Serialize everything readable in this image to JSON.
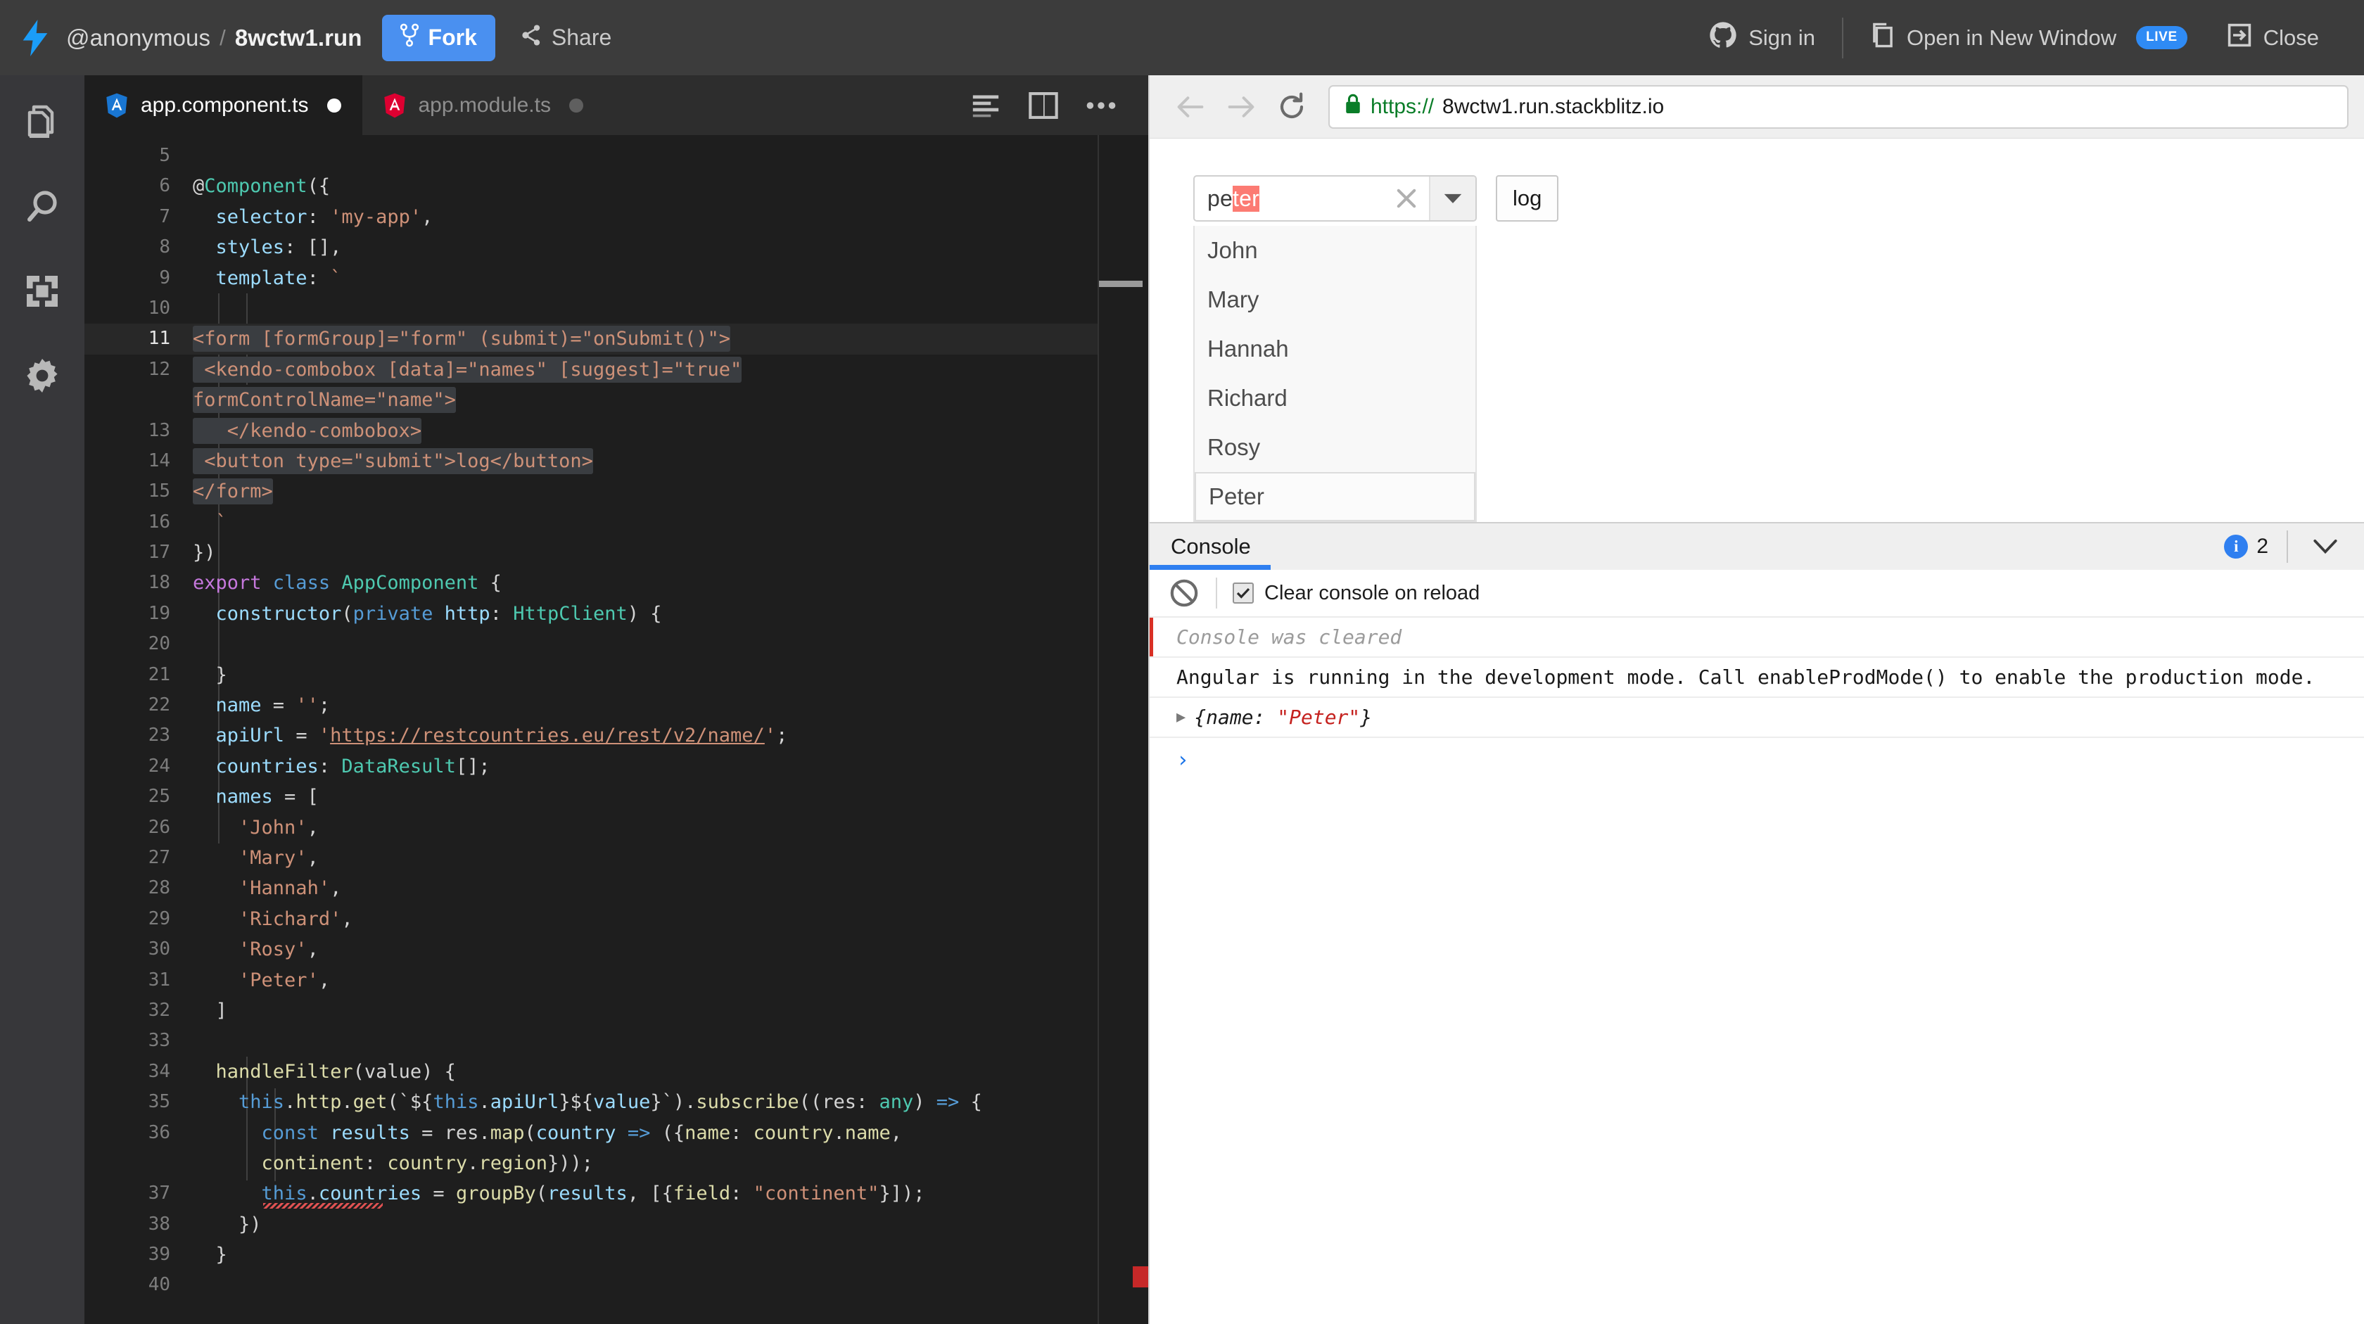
{
  "topbar": {
    "logo_icon": "lightning-bolt-icon",
    "user": "@anonymous",
    "separator": "/",
    "project": "8wctw1.run",
    "fork_label": "Fork",
    "fork_icon": "fork-icon",
    "share_label": "Share",
    "share_icon": "share-icon",
    "signin_label": "Sign in",
    "signin_icon": "github-icon",
    "open_new_window_label": "Open in New Window",
    "open_new_window_icon": "new-window-icon",
    "live_badge": "LIVE",
    "close_label": "Close",
    "close_icon": "exit-icon",
    "accent_color": "#4a90f0",
    "bar_color": "#3c3c3c"
  },
  "activitybar": {
    "items": [
      {
        "icon": "files-icon",
        "name": "project-files"
      },
      {
        "icon": "search-icon",
        "name": "search"
      },
      {
        "icon": "dependencies-icon",
        "name": "dependencies"
      },
      {
        "icon": "gear-icon",
        "name": "settings"
      }
    ]
  },
  "editor": {
    "tabs": [
      {
        "label": "app.component.ts",
        "icon": "angular-icon-blue",
        "active": true,
        "dirty": true
      },
      {
        "label": "app.module.ts",
        "icon": "angular-icon-red",
        "active": false,
        "dirty": true
      }
    ],
    "actions": [
      {
        "icon": "format-lines-icon",
        "name": "format-code"
      },
      {
        "icon": "split-editor-icon",
        "name": "split-editor"
      },
      {
        "icon": "more-options-icon",
        "name": "more-options"
      }
    ],
    "current_line": 11,
    "first_visible_line": 5,
    "lines": [
      {
        "n": "5",
        "blank": true
      },
      {
        "n": "6",
        "tokens": [
          {
            "t": "@",
            "c": "t-plain"
          },
          {
            "t": "Component",
            "c": "t-type"
          },
          {
            "t": "({",
            "c": "t-plain"
          }
        ]
      },
      {
        "n": "7",
        "tokens": [
          {
            "t": "  ",
            "c": "t-plain"
          },
          {
            "t": "selector",
            "c": "t-prop"
          },
          {
            "t": ": ",
            "c": "t-plain"
          },
          {
            "t": "'my-app'",
            "c": "t-str"
          },
          {
            "t": ",",
            "c": "t-plain"
          }
        ]
      },
      {
        "n": "8",
        "tokens": [
          {
            "t": "  ",
            "c": "t-plain"
          },
          {
            "t": "styles",
            "c": "t-prop"
          },
          {
            "t": ": [],",
            "c": "t-plain"
          }
        ]
      },
      {
        "n": "9",
        "tokens": [
          {
            "t": "  ",
            "c": "t-plain"
          },
          {
            "t": "template",
            "c": "t-prop"
          },
          {
            "t": ": ",
            "c": "t-plain"
          },
          {
            "t": "`",
            "c": "t-str"
          }
        ]
      },
      {
        "n": "10",
        "tokens": []
      },
      {
        "n": "11",
        "cur": true,
        "tokens": [
          {
            "t": "<form [formGroup]=\"form\" (submit)=\"onSubmit()\">",
            "c": "t-str",
            "sel": true
          }
        ]
      },
      {
        "n": "12",
        "tokens": [
          {
            "t": " <kendo-combobox [data]=\"names\" [suggest]=\"true\"",
            "c": "t-str",
            "sel": true
          }
        ]
      },
      {
        "n": "",
        "tokens": [
          {
            "t": "formControlName=\"name\">",
            "c": "t-str",
            "sel": true
          }
        ]
      },
      {
        "n": "13",
        "tokens": [
          {
            "t": "   </kendo-combobox>",
            "c": "t-str",
            "sel": true
          }
        ]
      },
      {
        "n": "14",
        "tokens": [
          {
            "t": " <button type=\"submit\">log</button>",
            "c": "t-str",
            "sel": true
          }
        ]
      },
      {
        "n": "15",
        "tokens": [
          {
            "t": "</form>",
            "c": "t-str",
            "sel": true
          }
        ]
      },
      {
        "n": "16",
        "tokens": [
          {
            "t": "  `",
            "c": "t-str"
          }
        ]
      },
      {
        "n": "17",
        "tokens": [
          {
            "t": "})",
            "c": "t-plain"
          }
        ]
      },
      {
        "n": "18",
        "tokens": [
          {
            "t": "export ",
            "c": "t-kw"
          },
          {
            "t": "class ",
            "c": "t-kw2"
          },
          {
            "t": "AppComponent",
            "c": "t-type"
          },
          {
            "t": " {",
            "c": "t-plain"
          }
        ]
      },
      {
        "n": "19",
        "tokens": [
          {
            "t": "  ",
            "c": "t-plain"
          },
          {
            "t": "constructor",
            "c": "t-prop"
          },
          {
            "t": "(",
            "c": "t-plain"
          },
          {
            "t": "private",
            "c": "t-kw2"
          },
          {
            "t": " ",
            "c": "t-plain"
          },
          {
            "t": "http",
            "c": "t-prop"
          },
          {
            "t": ": ",
            "c": "t-plain"
          },
          {
            "t": "HttpClient",
            "c": "t-type"
          },
          {
            "t": ") {",
            "c": "t-plain"
          }
        ]
      },
      {
        "n": "20",
        "tokens": []
      },
      {
        "n": "21",
        "tokens": [
          {
            "t": "  }",
            "c": "t-plain"
          }
        ]
      },
      {
        "n": "22",
        "tokens": [
          {
            "t": "  ",
            "c": "t-plain"
          },
          {
            "t": "name",
            "c": "t-prop"
          },
          {
            "t": " = ",
            "c": "t-plain"
          },
          {
            "t": "''",
            "c": "t-str"
          },
          {
            "t": ";",
            "c": "t-plain"
          }
        ]
      },
      {
        "n": "23",
        "tokens": [
          {
            "t": "  ",
            "c": "t-plain"
          },
          {
            "t": "apiUrl",
            "c": "t-prop"
          },
          {
            "t": " = ",
            "c": "t-plain"
          },
          {
            "t": "'",
            "c": "t-str"
          },
          {
            "t": "https://restcountries.eu/rest/v2/name/",
            "c": "t-str",
            "url": true
          },
          {
            "t": "'",
            "c": "t-str"
          },
          {
            "t": ";",
            "c": "t-plain"
          }
        ]
      },
      {
        "n": "24",
        "tokens": [
          {
            "t": "  ",
            "c": "t-plain"
          },
          {
            "t": "countries",
            "c": "t-prop"
          },
          {
            "t": ": ",
            "c": "t-plain"
          },
          {
            "t": "DataResult",
            "c": "t-type"
          },
          {
            "t": "[];",
            "c": "t-plain"
          }
        ]
      },
      {
        "n": "25",
        "tokens": [
          {
            "t": "  ",
            "c": "t-plain"
          },
          {
            "t": "names",
            "c": "t-prop"
          },
          {
            "t": " = [",
            "c": "t-plain"
          }
        ]
      },
      {
        "n": "26",
        "tokens": [
          {
            "t": "    ",
            "c": "t-plain"
          },
          {
            "t": "'John'",
            "c": "t-str"
          },
          {
            "t": ",",
            "c": "t-plain"
          }
        ]
      },
      {
        "n": "27",
        "tokens": [
          {
            "t": "    ",
            "c": "t-plain"
          },
          {
            "t": "'Mary'",
            "c": "t-str"
          },
          {
            "t": ",",
            "c": "t-plain"
          }
        ]
      },
      {
        "n": "28",
        "tokens": [
          {
            "t": "    ",
            "c": "t-plain"
          },
          {
            "t": "'Hannah'",
            "c": "t-str"
          },
          {
            "t": ",",
            "c": "t-plain"
          }
        ]
      },
      {
        "n": "29",
        "tokens": [
          {
            "t": "    ",
            "c": "t-plain"
          },
          {
            "t": "'Richard'",
            "c": "t-str"
          },
          {
            "t": ",",
            "c": "t-plain"
          }
        ]
      },
      {
        "n": "30",
        "tokens": [
          {
            "t": "    ",
            "c": "t-plain"
          },
          {
            "t": "'Rosy'",
            "c": "t-str"
          },
          {
            "t": ",",
            "c": "t-plain"
          }
        ]
      },
      {
        "n": "31",
        "tokens": [
          {
            "t": "    ",
            "c": "t-plain"
          },
          {
            "t": "'Peter'",
            "c": "t-str"
          },
          {
            "t": ",",
            "c": "t-plain"
          }
        ]
      },
      {
        "n": "32",
        "tokens": [
          {
            "t": "  ]",
            "c": "t-plain"
          }
        ]
      },
      {
        "n": "33",
        "tokens": []
      },
      {
        "n": "34",
        "tokens": [
          {
            "t": "  ",
            "c": "t-plain"
          },
          {
            "t": "handleFilter",
            "c": "t-fn"
          },
          {
            "t": "(",
            "c": "t-plain"
          },
          {
            "t": "value",
            "c": "t-plain"
          },
          {
            "t": ") {",
            "c": "t-plain"
          }
        ]
      },
      {
        "n": "35",
        "tokens": [
          {
            "t": "    ",
            "c": "t-plain"
          },
          {
            "t": "this",
            "c": "t-kw2"
          },
          {
            "t": ".",
            "c": "t-plain"
          },
          {
            "t": "http",
            "c": "t-fn"
          },
          {
            "t": ".",
            "c": "t-plain"
          },
          {
            "t": "get",
            "c": "t-fn"
          },
          {
            "t": "(`${",
            "c": "t-plain"
          },
          {
            "t": "this",
            "c": "t-kw2"
          },
          {
            "t": ".",
            "c": "t-plain"
          },
          {
            "t": "apiUrl",
            "c": "t-prop"
          },
          {
            "t": "}${",
            "c": "t-plain"
          },
          {
            "t": "value",
            "c": "t-prop"
          },
          {
            "t": "}`).",
            "c": "t-plain"
          },
          {
            "t": "subscribe",
            "c": "t-fn"
          },
          {
            "t": "((",
            "c": "t-plain"
          },
          {
            "t": "res",
            "c": "t-plain"
          },
          {
            "t": ": ",
            "c": "t-plain"
          },
          {
            "t": "any",
            "c": "t-type"
          },
          {
            "t": ") ",
            "c": "t-plain"
          },
          {
            "t": "=>",
            "c": "t-arrow"
          },
          {
            "t": " {",
            "c": "t-plain"
          }
        ]
      },
      {
        "n": "36",
        "tokens": [
          {
            "t": "      ",
            "c": "t-plain"
          },
          {
            "t": "const",
            "c": "t-kw2"
          },
          {
            "t": " ",
            "c": "t-plain"
          },
          {
            "t": "results",
            "c": "t-prop"
          },
          {
            "t": " = ",
            "c": "t-plain"
          },
          {
            "t": "res",
            "c": "t-plain"
          },
          {
            "t": ".",
            "c": "t-plain"
          },
          {
            "t": "map",
            "c": "t-fn"
          },
          {
            "t": "(",
            "c": "t-plain"
          },
          {
            "t": "country",
            "c": "t-prop"
          },
          {
            "t": " ",
            "c": "t-plain"
          },
          {
            "t": "=>",
            "c": "t-arrow"
          },
          {
            "t": " ({",
            "c": "t-plain"
          },
          {
            "t": "name",
            "c": "t-fn"
          },
          {
            "t": ": ",
            "c": "t-plain"
          },
          {
            "t": "country",
            "c": "t-fn"
          },
          {
            "t": ".",
            "c": "t-plain"
          },
          {
            "t": "name",
            "c": "t-fn"
          },
          {
            "t": ",",
            "c": "t-plain"
          }
        ]
      },
      {
        "n": "",
        "tokens": [
          {
            "t": "      ",
            "c": "t-plain"
          },
          {
            "t": "continent",
            "c": "t-fn"
          },
          {
            "t": ": ",
            "c": "t-plain"
          },
          {
            "t": "country",
            "c": "t-fn"
          },
          {
            "t": ".",
            "c": "t-plain"
          },
          {
            "t": "region",
            "c": "t-fn"
          },
          {
            "t": "}));",
            "c": "t-plain"
          }
        ]
      },
      {
        "n": "37",
        "squiggle": true,
        "tokens": [
          {
            "t": "      ",
            "c": "t-plain"
          },
          {
            "t": "this",
            "c": "t-kw2"
          },
          {
            "t": ".",
            "c": "t-plain"
          },
          {
            "t": "countries",
            "c": "t-prop"
          },
          {
            "t": " = ",
            "c": "t-plain"
          },
          {
            "t": "groupBy",
            "c": "t-fn"
          },
          {
            "t": "(",
            "c": "t-plain"
          },
          {
            "t": "results",
            "c": "t-prop"
          },
          {
            "t": ", [{",
            "c": "t-plain"
          },
          {
            "t": "field",
            "c": "t-fn"
          },
          {
            "t": ": ",
            "c": "t-plain"
          },
          {
            "t": "\"continent\"",
            "c": "t-str"
          },
          {
            "t": "}]);",
            "c": "t-plain"
          }
        ]
      },
      {
        "n": "38",
        "tokens": [
          {
            "t": "    })",
            "c": "t-plain"
          }
        ]
      },
      {
        "n": "39",
        "tokens": [
          {
            "t": "  }",
            "c": "t-plain"
          }
        ]
      },
      {
        "n": "40",
        "tokens": []
      }
    ]
  },
  "browser": {
    "back_icon": "arrow-left-icon",
    "forward_icon": "arrow-right-icon",
    "reload_icon": "reload-icon",
    "lock_icon": "lock-icon",
    "url_scheme": "https://",
    "url_host": "8wctw1.run.stackblitz.io"
  },
  "app_preview": {
    "combobox": {
      "typed": "pe",
      "suggestion": "ter",
      "clear_icon": "close-icon",
      "arrow_icon": "chevron-down-icon",
      "suggestion_color": "#fc7b73"
    },
    "log_button": "log",
    "dropdown_items": [
      {
        "label": "John",
        "focused": false
      },
      {
        "label": "Mary",
        "focused": false
      },
      {
        "label": "Hannah",
        "focused": false
      },
      {
        "label": "Richard",
        "focused": false
      },
      {
        "label": "Rosy",
        "focused": false
      },
      {
        "label": "Peter",
        "focused": true
      }
    ]
  },
  "console": {
    "title": "Console",
    "info_icon": "info-icon",
    "info_count": "2",
    "collapse_icon": "chevron-down-icon",
    "clear_icon": "ban-icon",
    "clear_on_reload_label": "Clear console on reload",
    "clear_on_reload_checked": true,
    "messages": [
      {
        "kind": "cleared",
        "text": "Console was cleared"
      },
      {
        "kind": "info",
        "text": "Angular is running in the development mode. Call enableProdMode() to enable the production mode."
      },
      {
        "kind": "object",
        "triangle": "▶",
        "prefix": "{name: ",
        "value": "\"Peter\"",
        "suffix": "}"
      }
    ],
    "prompt": "›"
  }
}
